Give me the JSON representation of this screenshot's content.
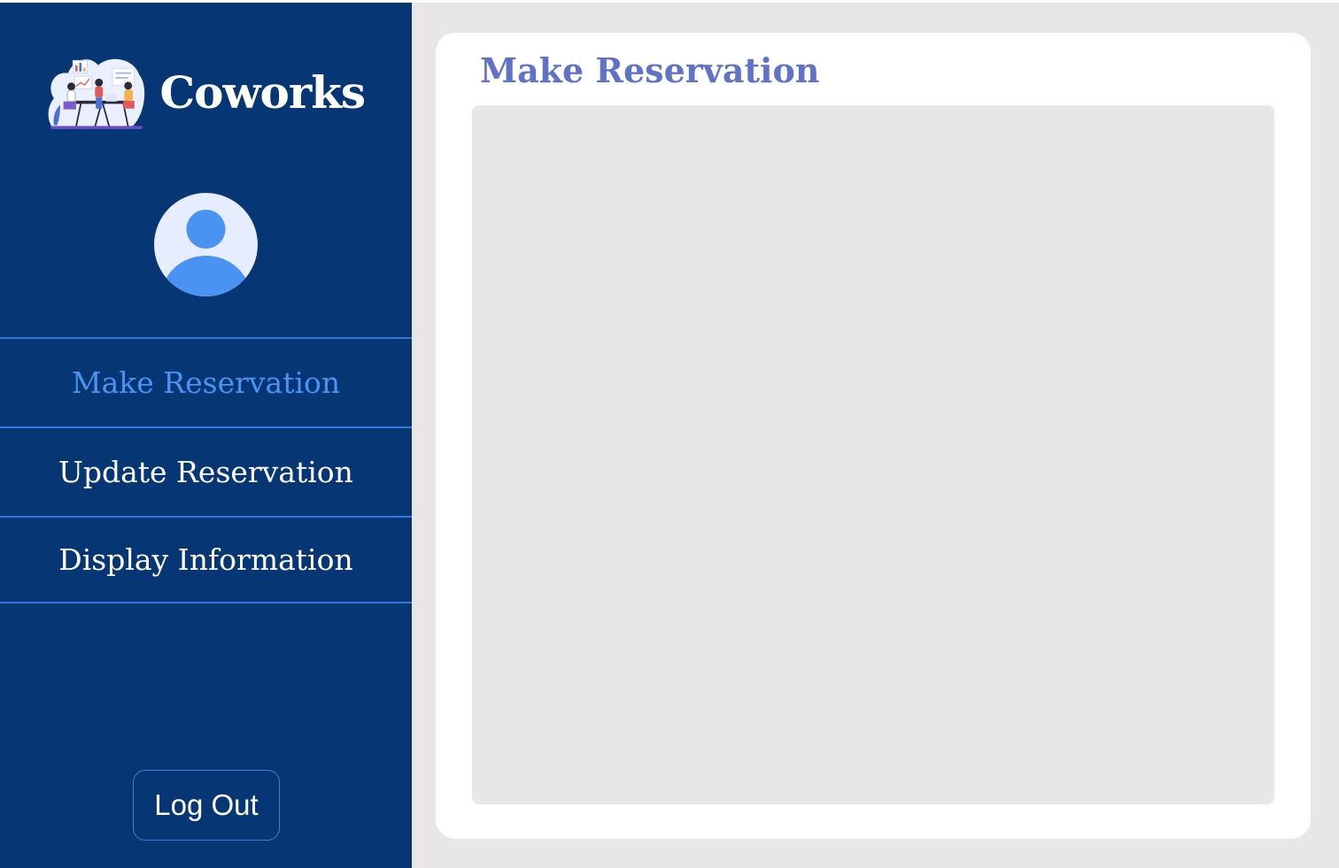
{
  "app": {
    "name": "Coworks"
  },
  "sidebar": {
    "logo_icon": "coworking-illustration-icon",
    "avatar_icon": "user-avatar-icon",
    "items": [
      {
        "label": "Make Reservation",
        "active": true
      },
      {
        "label": "Update Reservation",
        "active": false
      },
      {
        "label": "Display Information",
        "active": false
      }
    ],
    "logout_label": "Log Out"
  },
  "main": {
    "title": "Make Reservation"
  },
  "colors": {
    "sidebar_bg": "#063674",
    "active_nav": "#4a93f2",
    "divider": "#2f7ae0",
    "title": "#5f72c8",
    "page_bg": "#e8e6e7",
    "card_bg": "#ffffff",
    "avatar": "#4a93f2"
  }
}
